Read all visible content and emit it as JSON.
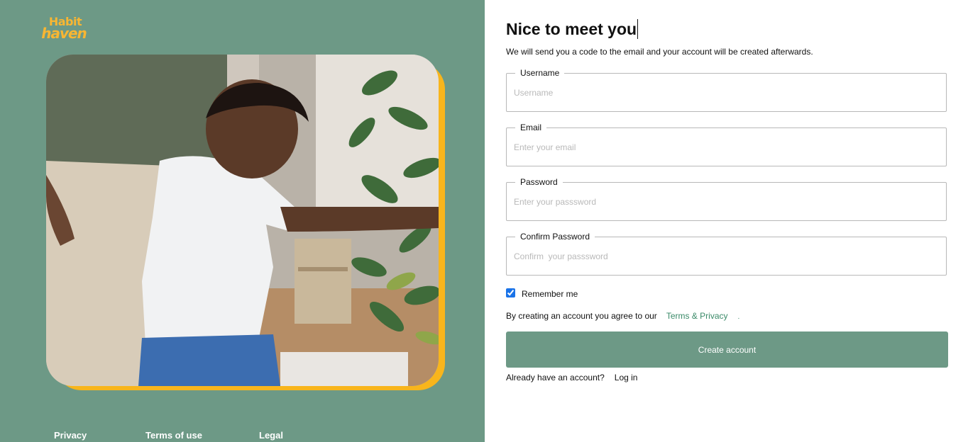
{
  "brand": {
    "line1": "Habit",
    "line2": "haven",
    "color": "#f8b632"
  },
  "colors": {
    "panel": "#6d9986",
    "accent_frame": "#f8b51c",
    "link": "#3a8a68"
  },
  "footer": {
    "privacy": "Privacy",
    "terms": "Terms of use",
    "legal": "Legal"
  },
  "form": {
    "title": "Nice to meet you",
    "subtitle": "We will send you a code to the email and your account will be created afterwards.",
    "username": {
      "label": "Username",
      "placeholder": "Username",
      "value": ""
    },
    "email": {
      "label": "Email",
      "placeholder": "Enter your email",
      "value": ""
    },
    "password": {
      "label": "Password",
      "placeholder": "Enter your passsword",
      "value": ""
    },
    "confirm": {
      "label": "Confirm Password",
      "placeholder": "Confirm  your passsword",
      "value": ""
    },
    "remember": {
      "label": "Remember me",
      "checked": true
    },
    "agree": {
      "text": "By creating an account you agree to our",
      "link": "Terms & Privacy",
      "trailing": "."
    },
    "create_button": "Create account",
    "already": {
      "text": "Already have an account?",
      "login": "Log in"
    }
  }
}
